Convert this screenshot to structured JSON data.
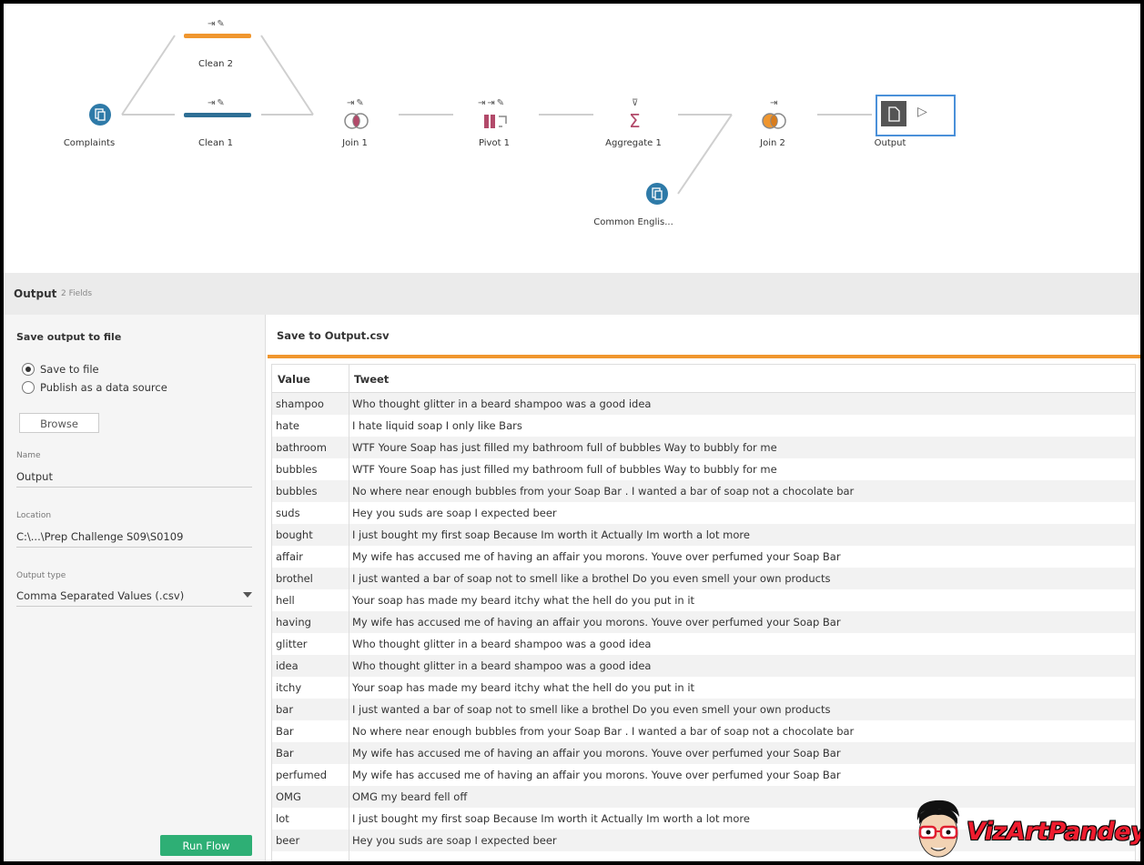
{
  "flow": {
    "nodes": {
      "complaints": "Complaints",
      "clean2": "Clean 2",
      "clean1": "Clean 1",
      "join1": "Join 1",
      "pivot1": "Pivot 1",
      "aggregate1": "Aggregate 1",
      "join2": "Join 2",
      "output": "Output",
      "common_english": "Common Englis..."
    },
    "colors": {
      "clean2": "#f0962e",
      "clean1": "#2e6f95",
      "input": "#2e7aa8"
    }
  },
  "toolbar": {
    "title": "Output",
    "fields": "2 Fields"
  },
  "left_panel": {
    "heading": "Save output to file",
    "radio_save": "Save to file",
    "radio_publish": "Publish as a data source",
    "browse": "Browse",
    "name_label": "Name",
    "name_value": "Output",
    "location_label": "Location",
    "location_value": "C:\\...\\Prep Challenge S09\\S0109",
    "type_label": "Output type",
    "type_value": "Comma Separated Values (.csv)",
    "run": "Run Flow"
  },
  "right_panel": {
    "title": "Save to Output.csv",
    "columns": [
      "Value",
      "Tweet"
    ],
    "rows": [
      [
        "shampoo",
        "Who thought glitter in a beard shampoo was a good idea"
      ],
      [
        "hate",
        "I hate liquid soap I only like Bars"
      ],
      [
        "bathroom",
        "WTF Youre Soap has just filled my bathroom full of bubbles Way to bubbly for me"
      ],
      [
        "bubbles",
        "WTF Youre Soap has just filled my bathroom full of bubbles Way to bubbly for me"
      ],
      [
        "bubbles",
        "No where near enough bubbles from your Soap Bar . I wanted a bar of soap not a chocolate bar"
      ],
      [
        "suds",
        "Hey  you suds are soap  I expected beer"
      ],
      [
        "bought",
        "I just bought my first  soap Because Im worth it Actually Im worth a lot more"
      ],
      [
        "affair",
        "My wife has accused me of having an affair you morons. Youve over perfumed your Soap Bar"
      ],
      [
        "brothel",
        "I just wanted a bar of soap not to smell like a brothel Do you even smell your own products"
      ],
      [
        "hell",
        "Your soap has made my beard itchy what the hell do you put in it"
      ],
      [
        "having",
        "My wife has accused me of having an affair you morons. Youve over perfumed your Soap Bar"
      ],
      [
        "glitter",
        "Who thought glitter in a beard shampoo was a good idea"
      ],
      [
        "idea",
        "Who thought glitter in a beard shampoo was a good idea"
      ],
      [
        "itchy",
        "Your soap has made my beard itchy what the hell do you put in it"
      ],
      [
        "bar",
        "I just wanted a bar of soap not to smell like a brothel Do you even smell your own products"
      ],
      [
        "Bar",
        "No where near enough bubbles from your Soap Bar . I wanted a bar of soap not a chocolate bar"
      ],
      [
        "Bar",
        "My wife has accused me of having an affair you morons. Youve over perfumed your Soap Bar"
      ],
      [
        "perfumed",
        "My wife has accused me of having an affair you morons. Youve over perfumed your Soap Bar"
      ],
      [
        "OMG",
        "OMG my beard fell off"
      ],
      [
        "lot",
        "I just bought my first  soap Because Im worth it Actually Im worth a lot more"
      ],
      [
        "beer",
        "Hey  you suds are soap  I expected beer"
      ]
    ]
  },
  "logo": "VizArtPandey"
}
